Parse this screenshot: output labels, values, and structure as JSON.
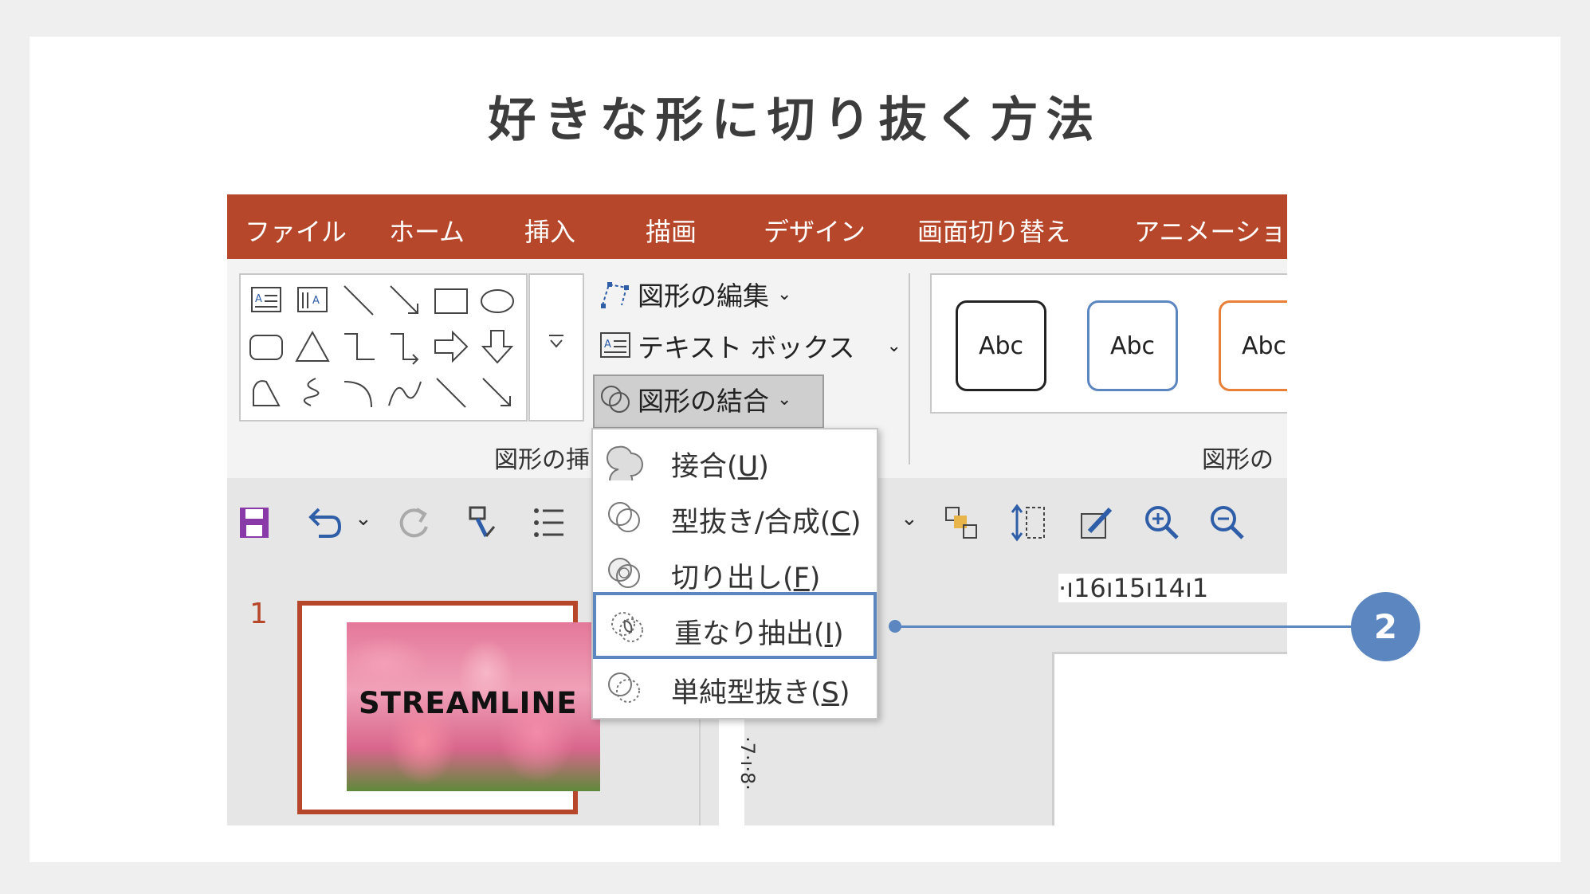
{
  "title": "好きな形に切り抜く方法",
  "ribbon_tabs": [
    "ファイル",
    "ホーム",
    "挿入",
    "描画",
    "デザイン",
    "画面切り替え",
    "アニメーション"
  ],
  "insert_shapes": {
    "edit_shape": "図形の編集",
    "text_box": "テキスト ボックス",
    "merge_shapes": "図形の結合",
    "group_label": "図形の挿"
  },
  "shape_styles": {
    "samples": [
      "Abc",
      "Abc",
      "Abc"
    ],
    "sample_colors": [
      "#222222",
      "#5b86bf",
      "#e8803a"
    ],
    "group_label": "図形の"
  },
  "merge_menu": {
    "items": [
      {
        "label_main": "接合(",
        "key": "U",
        "label_end": ")"
      },
      {
        "label_main": "型抜き/合成(",
        "key": "C",
        "label_end": ")"
      },
      {
        "label_main": "切り出し(",
        "key": "F",
        "label_end": ")"
      },
      {
        "label_main": "重なり抽出(",
        "key": "I",
        "label_end": ")"
      },
      {
        "label_main": "単純型抜き(",
        "key": "S",
        "label_end": ")"
      }
    ],
    "highlighted_index": 3
  },
  "slide_panel": {
    "slide_number": "1",
    "thumbnail_text": "STREAMLINE"
  },
  "horizontal_ruler": "·ı16ı15ı14ı1",
  "vertical_ruler": "·7·ı·8·",
  "callout": {
    "number": "2"
  },
  "colors": {
    "ribbon_tab_bg": "#b7472a",
    "accent_blue": "#5b86bf",
    "save_icon": "#8a3aa8"
  }
}
